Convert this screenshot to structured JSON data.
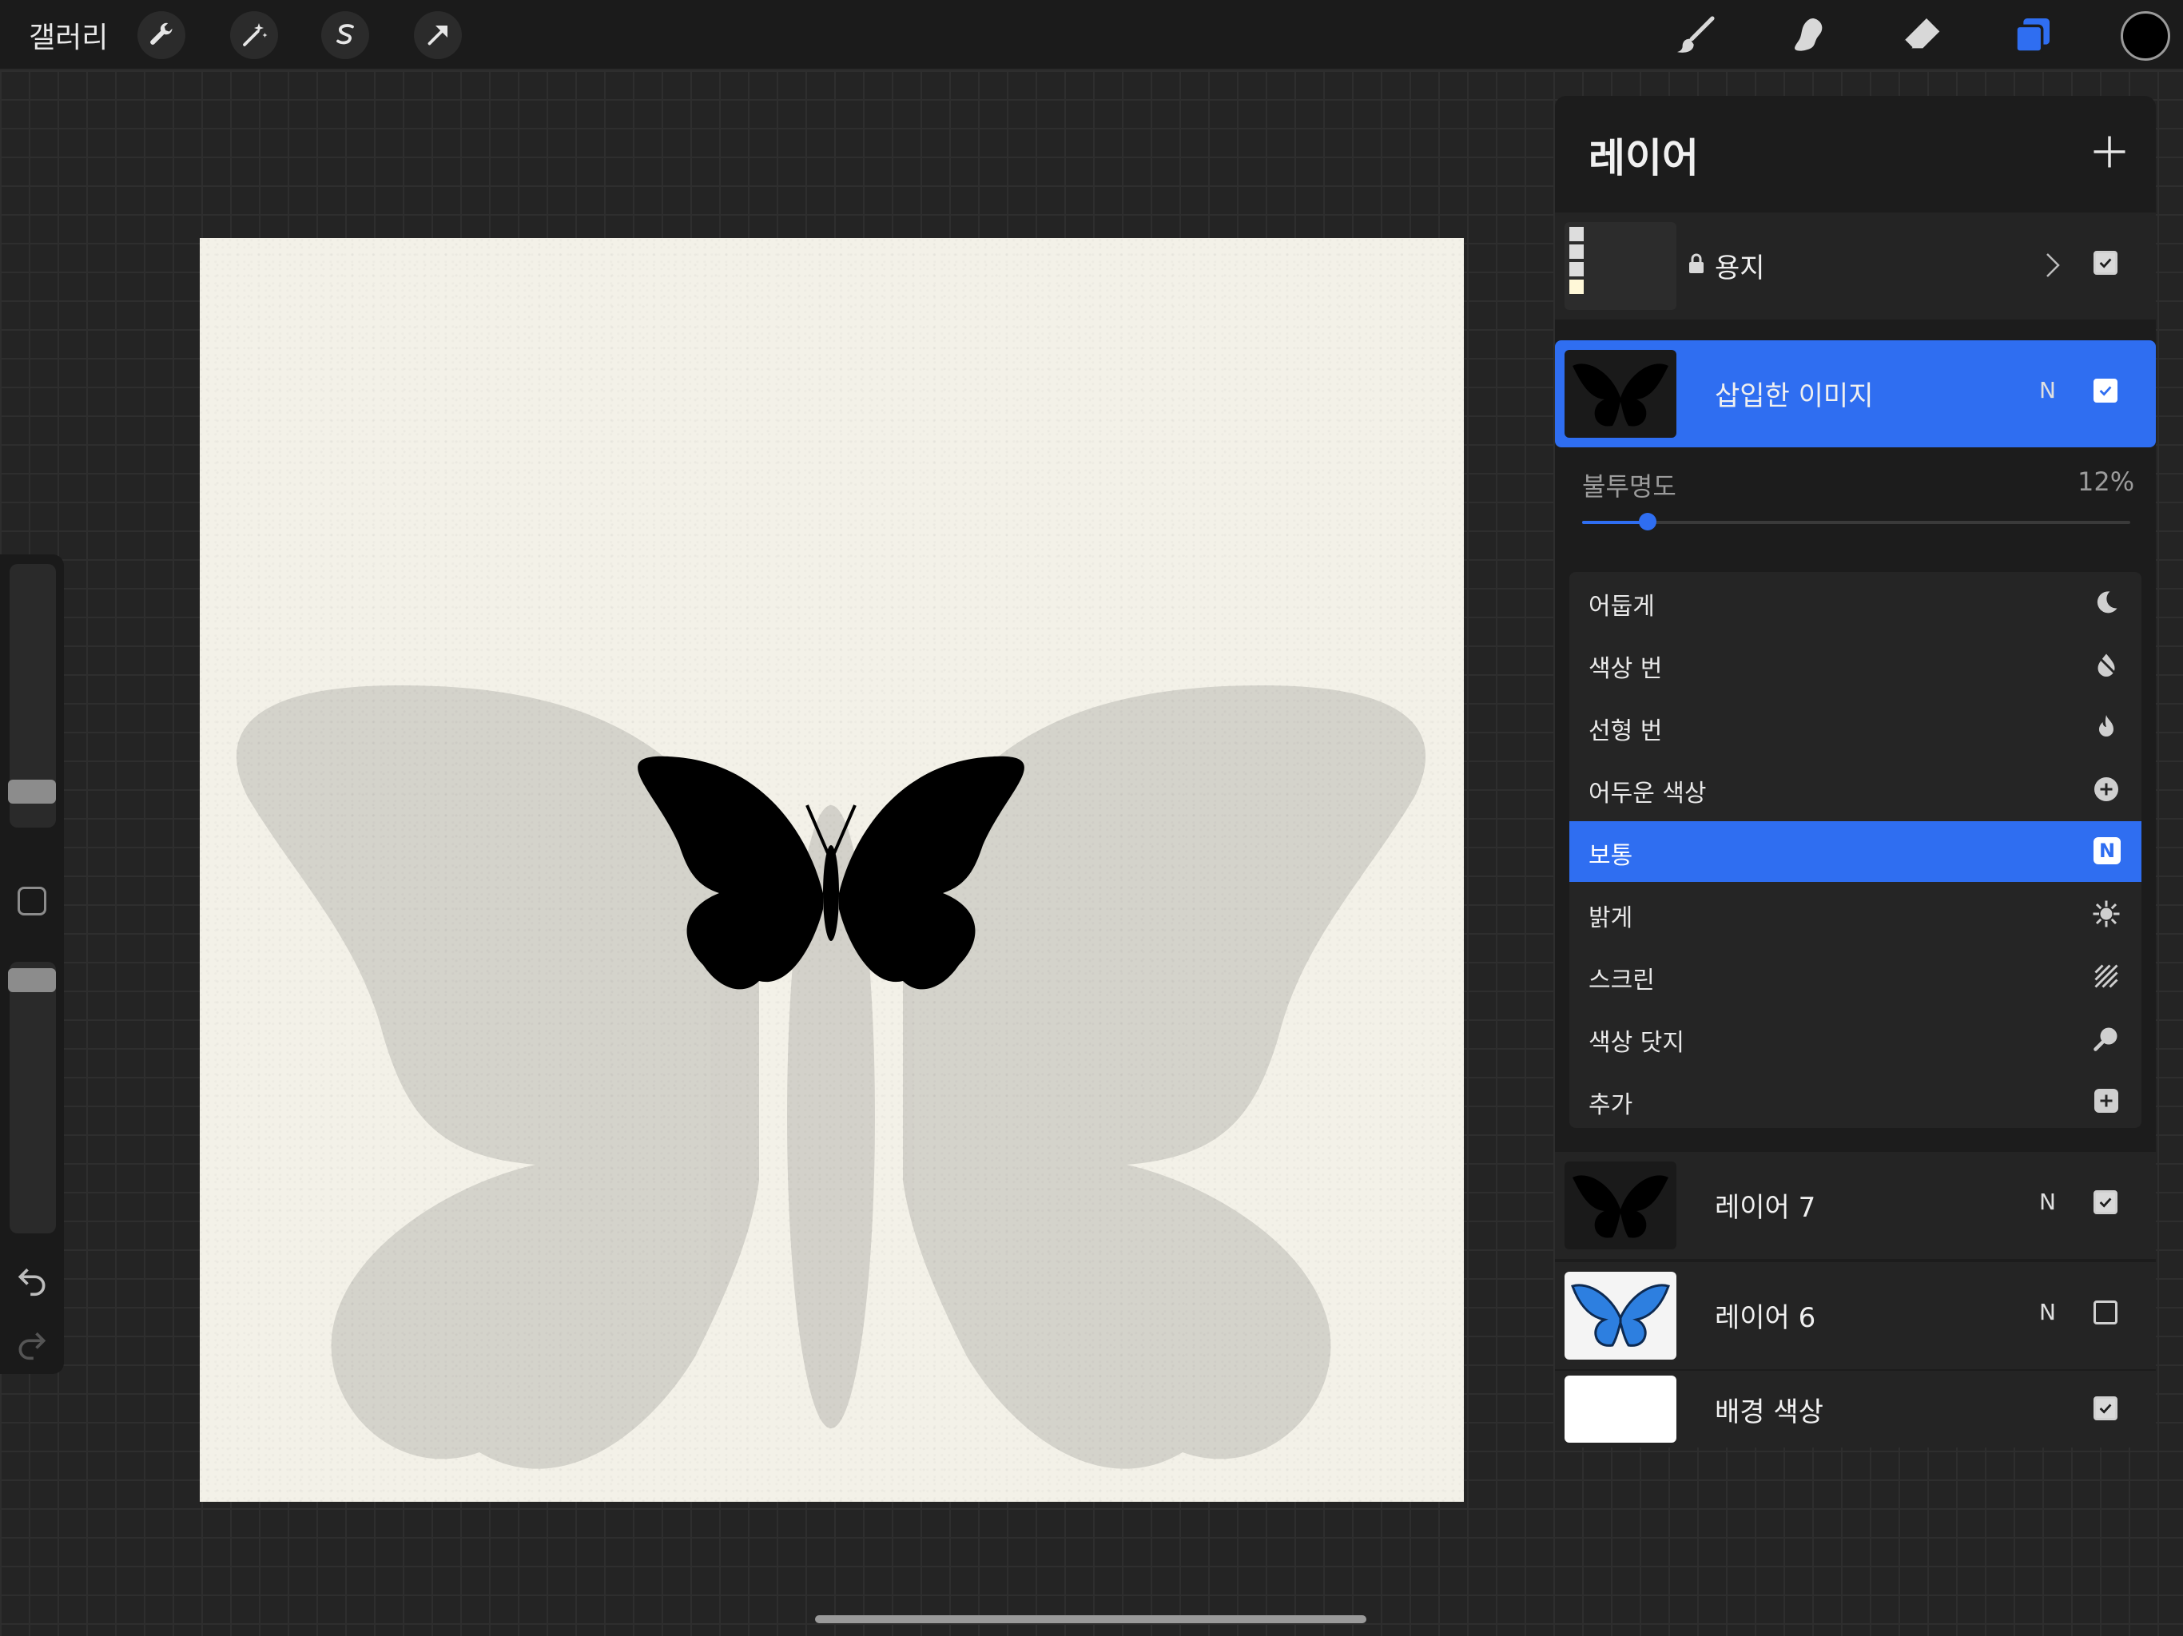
{
  "topbar": {
    "gallery_label": "갤러리",
    "left_tools": [
      "wrench-icon",
      "magic-wand-icon",
      "selection-icon",
      "transform-arrow-icon"
    ],
    "right_tools": [
      "brush-icon",
      "smudge-icon",
      "eraser-icon",
      "layers-icon"
    ],
    "current_color": "#000000",
    "accent_color": "#2f6ef1"
  },
  "layers_panel": {
    "title": "레이어",
    "layers": [
      {
        "name": "용지",
        "blend": "",
        "visible": true,
        "locked": true,
        "group": true
      },
      {
        "name": "삽입한 이미지",
        "blend": "N",
        "visible": true,
        "active": true
      },
      {
        "name": "레이어 7",
        "blend": "N",
        "visible": true
      },
      {
        "name": "레이어 6",
        "blend": "N",
        "visible": false
      },
      {
        "name": "배경 색상",
        "blend": "",
        "visible": true
      }
    ],
    "opacity": {
      "label": "불투명도",
      "value_text": "12%",
      "value": 12
    },
    "blend_modes": [
      {
        "label": "어둡게",
        "icon": "moon-icon"
      },
      {
        "label": "색상 번",
        "icon": "burn-drop-icon"
      },
      {
        "label": "선형 번",
        "icon": "flame-icon"
      },
      {
        "label": "어두운 색상",
        "icon": "plus-circle-icon"
      },
      {
        "label": "보통",
        "icon": "n-badge-icon",
        "selected": true,
        "badge": "N"
      },
      {
        "label": "밝게",
        "icon": "sunburst-icon"
      },
      {
        "label": "스크린",
        "icon": "hatched-square-icon"
      },
      {
        "label": "색상 닷지",
        "icon": "dodge-icon"
      },
      {
        "label": "추가",
        "icon": "plus-square-icon"
      }
    ]
  }
}
